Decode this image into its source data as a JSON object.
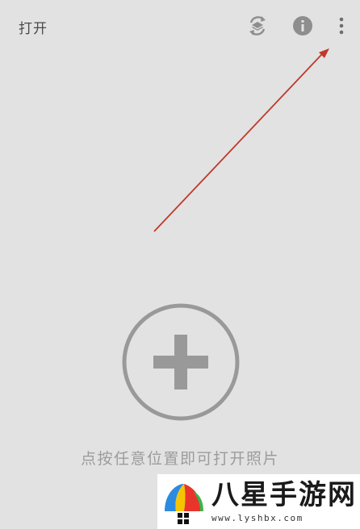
{
  "toolbar": {
    "open_label": "打开",
    "icons": [
      "layers-swap-icon",
      "info-icon",
      "more-vert-icon"
    ]
  },
  "main": {
    "hint": "点按任意位置即可打开照片",
    "add_icon": "add-circle-icon"
  },
  "annotation": {
    "color": "#c0392b"
  },
  "watermark": {
    "title": "八星手游网",
    "url": "www.lyshbx.com"
  },
  "colors": {
    "background": "#e2e2e2",
    "icon_gray": "#8e8e8e",
    "hint_text": "#9c9c9c"
  }
}
